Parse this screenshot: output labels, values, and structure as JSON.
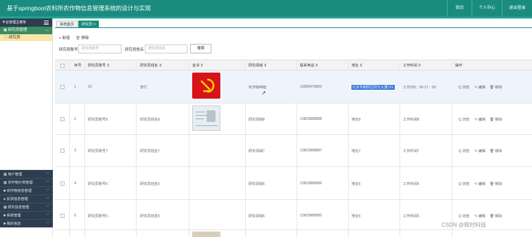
{
  "header": {
    "title": "基于springboot农科所农作物信息管理系统的设计与实现",
    "nav": [
      "首页",
      "个人中心",
      "退出登录"
    ],
    "bg_color": "#1a8c7f"
  },
  "sidebar": {
    "heading": "平台管理主菜单",
    "active_group": "研究员管理",
    "active_sub": "研究员",
    "items": [
      "用户管理",
      "农作物分类管理",
      "农作物信息管理",
      "反馈信息管理",
      "研究信息管理",
      "系统管理",
      "我的信息"
    ],
    "dark_color": "#2d3e50",
    "active_color": "#3a8c62",
    "sub_color": "#fbe6a8"
  },
  "tabs": [
    "系统首页",
    "研究员 ×"
  ],
  "toolbar": {
    "add": "新增",
    "delete": "移除"
  },
  "search": {
    "label1": "研究员账号",
    "placeholder1": "研究员账号",
    "label2": "研究员姓名",
    "placeholder2": "研究员姓名",
    "button": "搜索"
  },
  "table": {
    "columns": [
      "序号",
      "研究员账号 ⇕",
      "研究员姓名 ⇕",
      "证书 ⇕",
      "研究领域 ⇕",
      "联系电话 ⇕",
      "地址 ⇕",
      "工作时间 ⇕",
      "操作"
    ],
    "rows": [
      {
        "no": "1",
        "account": "22",
        "name": "李行",
        "field": "农作物种植",
        "phone": "13958476853",
        "address": "北京市朝阳区阳光大厦101",
        "worktime": "工作日8：00-17：00"
      },
      {
        "no": "2",
        "account": "研究员账号8",
        "name": "研究员姓名8",
        "field": "研究领域8",
        "phone": "13823888888",
        "address": "地址8",
        "worktime": "工作时间8"
      },
      {
        "no": "3",
        "account": "研究员账号7",
        "name": "研究员姓名7",
        "field": "研究领域7",
        "phone": "13823888887",
        "address": "地址7",
        "worktime": "工作时间7"
      },
      {
        "no": "4",
        "account": "研究员账号6",
        "name": "研究员姓名6",
        "field": "研究领域6",
        "phone": "13823888886",
        "address": "地址6",
        "worktime": "工作时间6"
      },
      {
        "no": "5",
        "account": "研究员账号5",
        "name": "研究员姓名5",
        "field": "研究领域5",
        "phone": "13823888885",
        "address": "地址5",
        "worktime": "工作时间5"
      }
    ],
    "actions": [
      "Q 浏览",
      "✎ 编辑",
      "🗑 移除"
    ]
  },
  "watermark": "CSDN @辉时科技"
}
